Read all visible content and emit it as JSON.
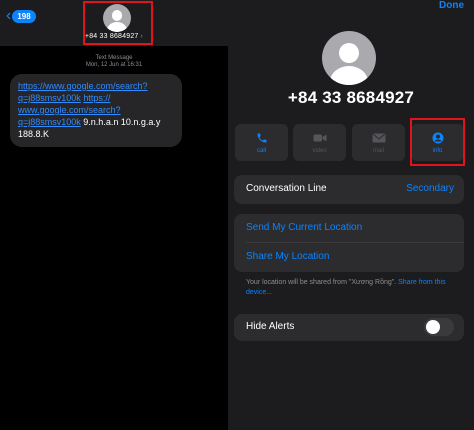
{
  "left_panel": {
    "back_badge": "198",
    "contact_number": "+84 33 8684927",
    "message_type": "Text Message",
    "message_time": "Mon, 12 Jun at 16:31",
    "message": {
      "line1": "https://www.google.com/search?",
      "line2a": "q=j88smsv100k",
      "line2b": "https://",
      "line3": "www.google.com/search?",
      "line4a": "q=j88smsv100k",
      "line4b": " 9.n.h.a.n 10.n.g.a.y",
      "line5": "188.8.K"
    }
  },
  "right_panel": {
    "done_label": "Done",
    "contact_number": "+84 33 8684927",
    "actions": [
      {
        "label": "call",
        "icon": "phone-icon",
        "enabled": true
      },
      {
        "label": "video",
        "icon": "video-icon",
        "enabled": false
      },
      {
        "label": "mail",
        "icon": "mail-icon",
        "enabled": false
      },
      {
        "label": "info",
        "icon": "person-info-icon",
        "enabled": true
      }
    ],
    "conversation_line": {
      "label": "Conversation Line",
      "value": "Secondary"
    },
    "location": {
      "send_label": "Send My Current Location",
      "share_label": "Share My Location"
    },
    "location_note": {
      "text": "Your location will be shared from \"Xương Rồng\".",
      "link": "Share from this device..."
    },
    "hide_alerts": {
      "label": "Hide Alerts",
      "enabled": false
    }
  },
  "colors": {
    "accent": "#0a84ff",
    "highlight_box": "#e0141e",
    "bubble": "#262629",
    "panel": "#1c1c1e"
  }
}
